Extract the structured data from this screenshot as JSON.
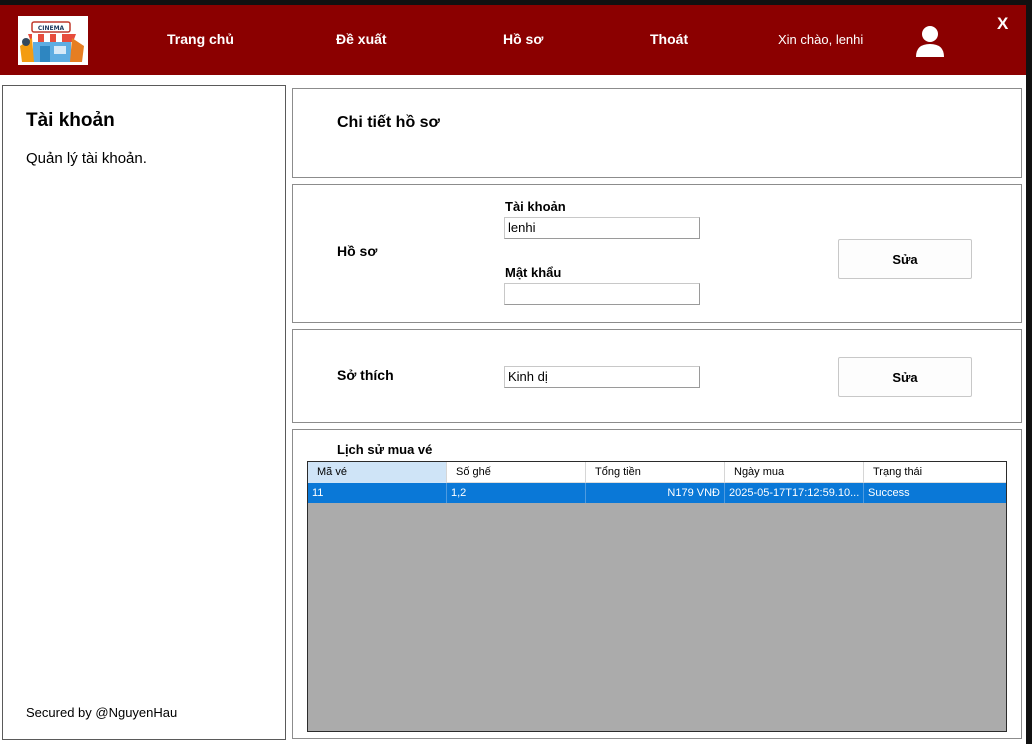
{
  "header": {
    "nav": [
      "Trang chủ",
      "Đề xuất",
      "Hồ sơ",
      "Thoát"
    ],
    "greeting": "Xin chào, lenhi",
    "close": "X",
    "logo_text": "CINEMA"
  },
  "sidebar": {
    "title": "Tài khoản",
    "subtitle": "Quản lý tài khoản.",
    "footer": "Secured by @NguyenHau"
  },
  "detail": {
    "title": "Chi tiết hồ sơ"
  },
  "profile": {
    "title": "Hồ sơ",
    "account_label": "Tài khoản",
    "account_value": "lenhi",
    "password_label": "Mật khẩu",
    "password_value": "",
    "edit_label": "Sửa"
  },
  "hobby": {
    "title": "Sở thích",
    "value": "Kinh dị",
    "edit_label": "Sửa"
  },
  "history": {
    "title": "Lịch sử mua vé",
    "columns": [
      "Mã vé",
      "Số ghế",
      "Tổng tiền",
      "Ngày mua",
      "Trạng thái"
    ],
    "rows": [
      [
        "11",
        "1,2",
        "N179 VNĐ",
        "2025-05-17T17:12:59.10...",
        "Success"
      ]
    ]
  },
  "colors": {
    "header_bg": "#8b0000",
    "selected_row": "#0a78d7",
    "grid_bg": "#ababab"
  }
}
